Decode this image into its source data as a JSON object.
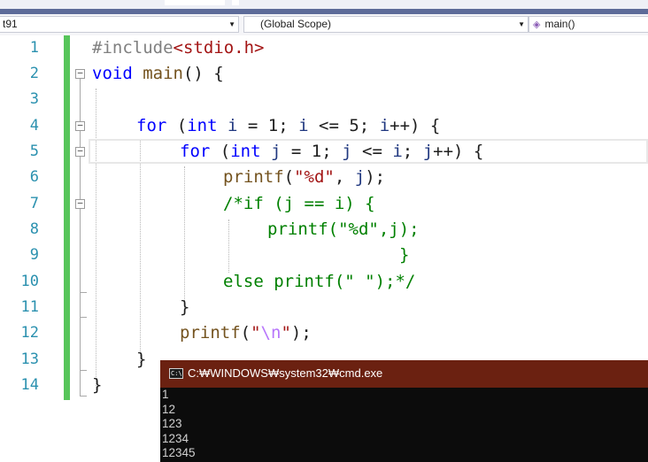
{
  "navbar": {
    "project_combo": "t91",
    "scope_combo": "(Global Scope)",
    "function_combo": "main()"
  },
  "editor": {
    "line_numbers": [
      "1",
      "2",
      "3",
      "4",
      "5",
      "6",
      "7",
      "8",
      "9",
      "10",
      "11",
      "12",
      "13",
      "14"
    ],
    "lines": {
      "l1_directive": "#include",
      "l1_header": "<stdio.h>",
      "l2_void": "void",
      "l2_main": "main",
      "l2_rest": "() {",
      "l4_for": "for",
      "l4_int": "int",
      "l4_i1": "i",
      "l4_eq": " = ",
      "l4_one": "1",
      "l4_semi1": "; ",
      "l4_i2": "i",
      "l4_le": " <= ",
      "l4_five": "5",
      "l4_semi2": "; ",
      "l4_i3": "i",
      "l4_end": "++) {",
      "l5_for": "for",
      "l5_int": "int",
      "l5_j1": "j",
      "l5_eq": " = ",
      "l5_one": "1",
      "l5_semi1": "; ",
      "l5_j2": "j",
      "l5_le": " <= ",
      "l5_i": "i",
      "l5_semi2": "; ",
      "l5_j3": "j",
      "l5_end": "++) {",
      "l6_printf": "printf",
      "l6_open": "(",
      "l6_str": "\"%d\"",
      "l6_comma": ", ",
      "l6_j": "j",
      "l6_close": ");",
      "l7": "/*if (j == i) {",
      "l8": "printf(\"%d\",j);",
      "l9": "}",
      "l10": "else printf(\" \");*/",
      "l11": "}",
      "l12_printf": "printf",
      "l12_open": "(",
      "l12_q1": "\"",
      "l12_esc": "\\n",
      "l12_q2": "\"",
      "l12_close": ");",
      "l13": "}",
      "l14": "}"
    }
  },
  "console": {
    "title": "C:₩WINDOWS₩system32₩cmd.exe",
    "icon_text": "C:\\",
    "output": [
      "1",
      "12",
      "123",
      "1234",
      "12345"
    ]
  },
  "colors": {
    "keyword": "#0000ff",
    "string": "#a31515",
    "comment": "#008000",
    "line_number": "#2b91af",
    "change_bar": "#57c55a",
    "console_title": "#6b2111"
  }
}
